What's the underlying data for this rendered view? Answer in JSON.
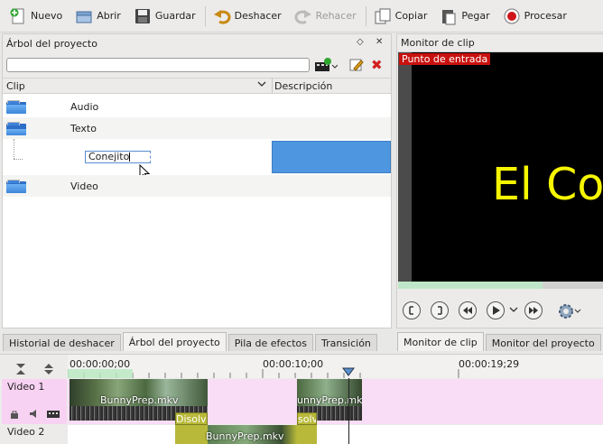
{
  "toolbar": {
    "new": "Nuevo",
    "open": "Abrir",
    "save": "Guardar",
    "undo": "Deshacer",
    "redo": "Rehacer",
    "copy": "Copiar",
    "paste": "Pegar",
    "render": "Procesar"
  },
  "project_tree": {
    "title": "Árbol del proyecto",
    "search_value": "",
    "col_clip": "Clip",
    "col_description": "Descripción",
    "items": [
      {
        "label": "Audio"
      },
      {
        "label": "Texto"
      },
      {
        "label": "Conejito"
      },
      {
        "label": "Video"
      }
    ]
  },
  "left_tabs": [
    "Historial de deshacer",
    "Árbol del proyecto",
    "Pila de efectos",
    "Transición"
  ],
  "monitor": {
    "title": "Monitor de clip",
    "entry_badge": "Punto de entrada",
    "screen_text": "El Co"
  },
  "right_tabs": [
    "Monitor de clip",
    "Monitor del proyecto"
  ],
  "timeline": {
    "timecodes": [
      "00:00:00;00",
      "00:00:10;00",
      "00:00:19;29"
    ],
    "tracks": [
      {
        "label": "Video 1"
      },
      {
        "label": "Video 2"
      }
    ],
    "clips": [
      {
        "label": "BunnyPrep.mkv"
      },
      {
        "label": "unnyPrep.mkv"
      },
      {
        "label": "Disolve"
      },
      {
        "label": "solve"
      },
      {
        "label": "BunnyPrep.mkv"
      }
    ]
  },
  "colors": {
    "selection": "#4f96e0",
    "entry_badge": "#c8120f",
    "monitor_text": "#f6f600",
    "track_pink": "#f8d2f2"
  }
}
